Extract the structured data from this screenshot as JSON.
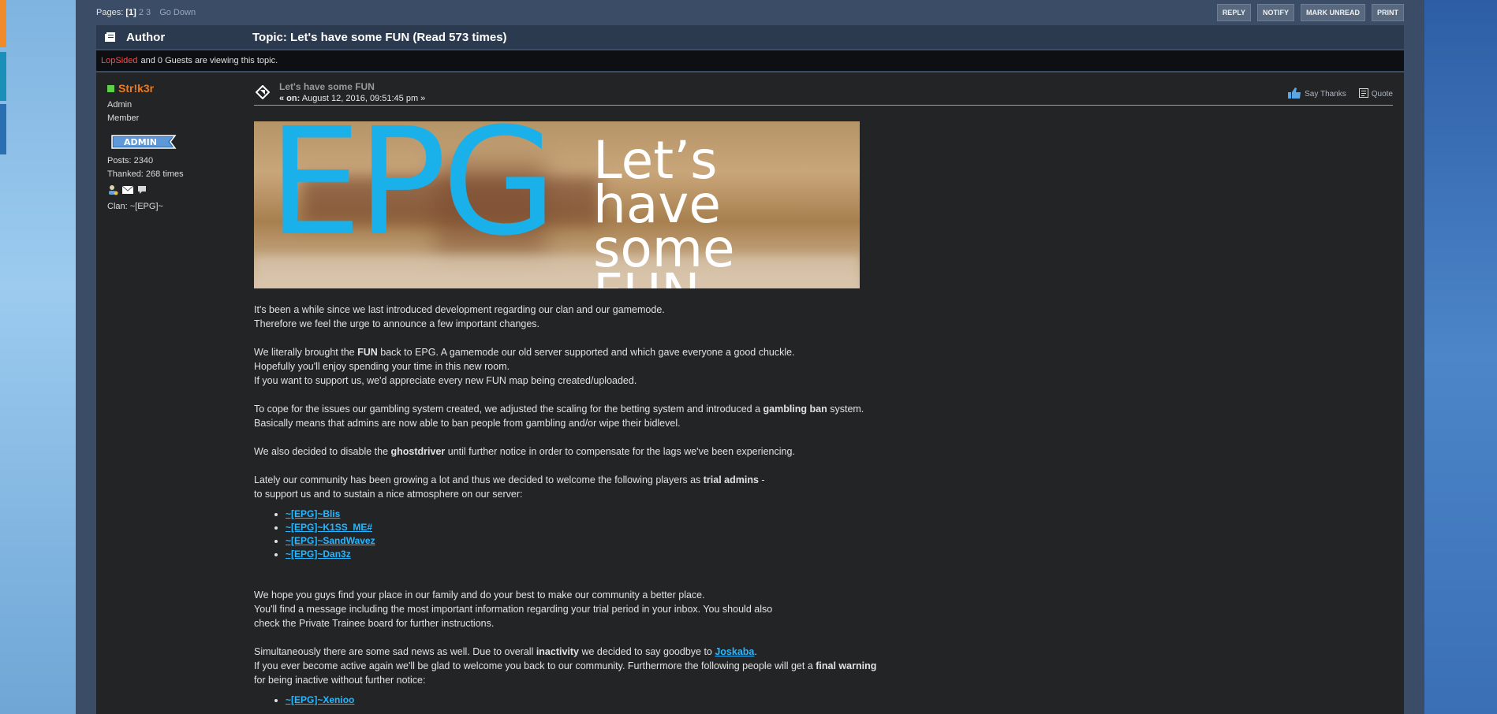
{
  "topbar": {
    "pages_label": "Pages:",
    "current_page": "[1]",
    "other_pages": [
      "2",
      "3"
    ],
    "go_down": "Go Down",
    "buttons": [
      "REPLY",
      "NOTIFY",
      "MARK UNREAD",
      "PRINT"
    ]
  },
  "header": {
    "author_label": "Author",
    "topic_title": "Topic: Let's have some FUN  (Read 573 times)"
  },
  "viewing": {
    "user": "LopSided",
    "text": "and 0 Guests are viewing this topic."
  },
  "poster": {
    "name": "Str!k3r",
    "role": "Admin",
    "group": "Member",
    "badge": "ADMIN",
    "posts": "Posts: 2340",
    "thanked": "Thanked: 268 times",
    "clan": "Clan: ~[EPG]~"
  },
  "post": {
    "subject": "Let's have some FUN",
    "date_prefix": "« on:",
    "date": "August 12, 2016, 09:51:45 pm »",
    "say_thanks": "Say Thanks",
    "quote": "Quote",
    "banner": {
      "big": "EPG",
      "line1": "Let’s have",
      "line2": "some",
      "line3": "FUN"
    },
    "p1a": "It's been a while since we last introduced development regarding our clan and our gamemode.",
    "p1b": "Therefore we feel the urge to announce a few important changes.",
    "p2a_pre": "We literally brought the ",
    "p2a_bold": "FUN",
    "p2a_post": " back to EPG. A gamemode our old server supported and which gave everyone a good chuckle.",
    "p2b": "Hopefully you'll enjoy spending your time in this new room.",
    "p2c": "If you want to support us, we'd appreciate every new FUN map being created/uploaded.",
    "p3a_pre": "To cope for the issues our gambling system created, we adjusted the scaling for the betting system and introduced a ",
    "p3a_bold": "gambling ban",
    "p3a_post": " system.",
    "p3b": "Basically means that admins are now able to ban people from gambling and/or wipe their bidlevel.",
    "p4_pre": "We also decided to disable the ",
    "p4_bold": "ghostdriver",
    "p4_post": " until further notice in order to compensate for the lags we've been experiencing.",
    "p5a_pre": "Lately our community has been growing a lot and thus we decided to welcome the following players as ",
    "p5a_bold": "trial admins",
    "p5a_post": " -",
    "p5b": "to support us and to sustain a nice atmosphere on our server:",
    "trial_admins": [
      "~[EPG]~Blis",
      "~[EPG]~K1SS_ME#",
      "~[EPG]~SandWavez",
      "~[EPG]~Dan3z"
    ],
    "p6a": "We hope you guys find your place in our family and do your best to make our community a better place.",
    "p6b": "You'll find a message including the most important information regarding your trial period in your inbox. You should also",
    "p6c": "check the Private Trainee board for further instructions.",
    "p7a_pre": "Simultaneously there are some sad news as well. Due to overall ",
    "p7a_bold": "inactivity",
    "p7a_mid": " we decided to say goodbye to ",
    "p7a_link": "Joskaba",
    "p7a_post": ".",
    "p7b_pre": "If you ever become active again we'll be glad to welcome you back to our community. Furthermore the following people will get a ",
    "p7b_bold": "final warning",
    "p7c": "for being inactive without further notice:",
    "warned": [
      "~[EPG]~Xenioo"
    ]
  },
  "colors": {
    "accent_link": "#28b7ff",
    "poster_name": "#f07a1a",
    "viewing_user": "#ff4a4a",
    "banner_epg": "#1ab0ea"
  }
}
